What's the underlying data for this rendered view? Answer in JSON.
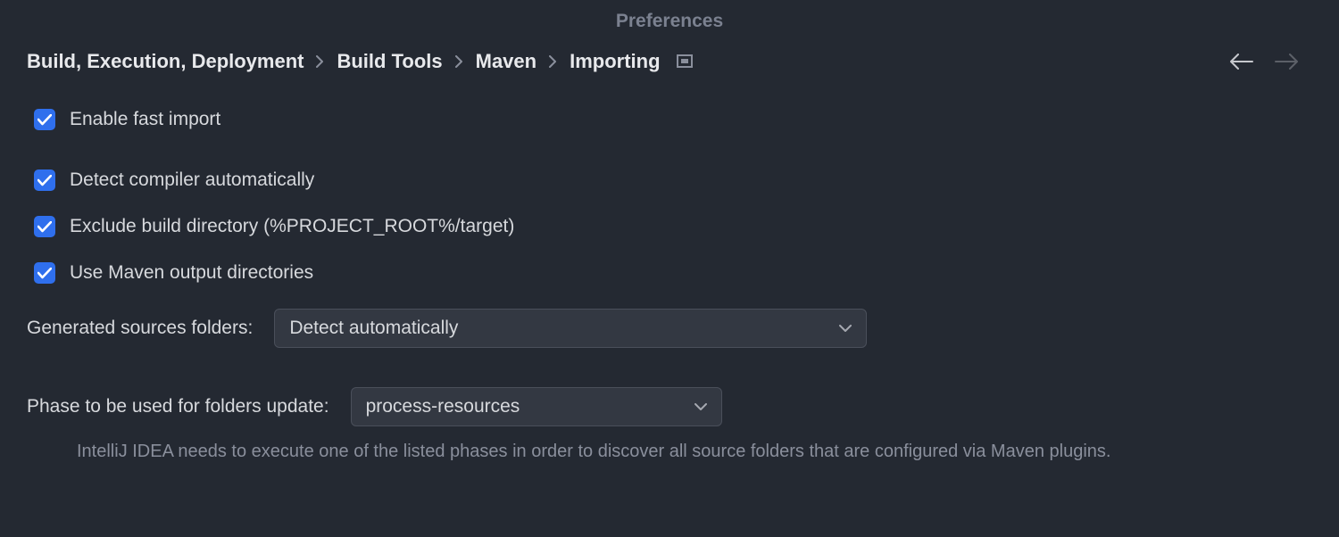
{
  "window": {
    "title": "Preferences"
  },
  "breadcrumb": {
    "items": [
      "Build, Execution, Deployment",
      "Build Tools",
      "Maven",
      "Importing"
    ]
  },
  "checks": {
    "enable_fast_import": "Enable fast import",
    "detect_compiler": "Detect compiler automatically",
    "exclude_build_dir": "Exclude build directory (%PROJECT_ROOT%/target)",
    "use_maven_output": "Use Maven output directories"
  },
  "form": {
    "generated_sources_label": "Generated sources folders:",
    "generated_sources_value": "Detect automatically",
    "phase_label": "Phase to be used for folders update:",
    "phase_value": "process-resources",
    "help": "IntelliJ IDEA needs to execute one of the listed phases in order to discover all source folders that are configured via Maven plugins."
  }
}
